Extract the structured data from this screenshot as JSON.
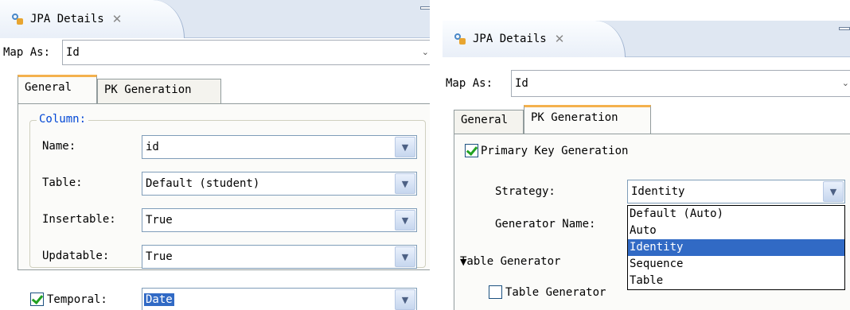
{
  "left": {
    "view_title": "JPA Details",
    "close_glyph": "✕",
    "map_as_label": "Map As:",
    "map_as_value": "Id",
    "tabs": [
      "General",
      "PK Generation"
    ],
    "column_group": "Column:",
    "rows": [
      {
        "label": "Name:",
        "value": "id"
      },
      {
        "label": "Table:",
        "value": "Default (student)"
      },
      {
        "label": "Insertable:",
        "value": "True"
      },
      {
        "label": "Updatable:",
        "value": "True"
      }
    ],
    "temporal_label": "Temporal:",
    "temporal_checked": true,
    "temporal_value": "Date"
  },
  "right": {
    "view_title": "JPA Details",
    "close_glyph": "✕",
    "map_as_label": "Map As:",
    "map_as_value": "Id",
    "tabs": [
      "General",
      "PK Generation"
    ],
    "pk_gen_label": "Primary Key Generation",
    "pk_gen_checked": true,
    "strategy_label": "Strategy:",
    "strategy_value": "Identity",
    "generator_name_label": "Generator Name:",
    "strategy_options": [
      "Default (Auto)",
      "Auto",
      "Identity",
      "Sequence",
      "Table"
    ],
    "highlighted_option": "Identity",
    "table_generator_section": "Table Generator",
    "table_generator_check": "Table Generator",
    "table_generator_checked": false
  },
  "colors": {
    "accent_tab": "#f4b14d",
    "selection": "#316ac5",
    "group_legend": "#0046d5",
    "check_mark": "#21a121"
  }
}
